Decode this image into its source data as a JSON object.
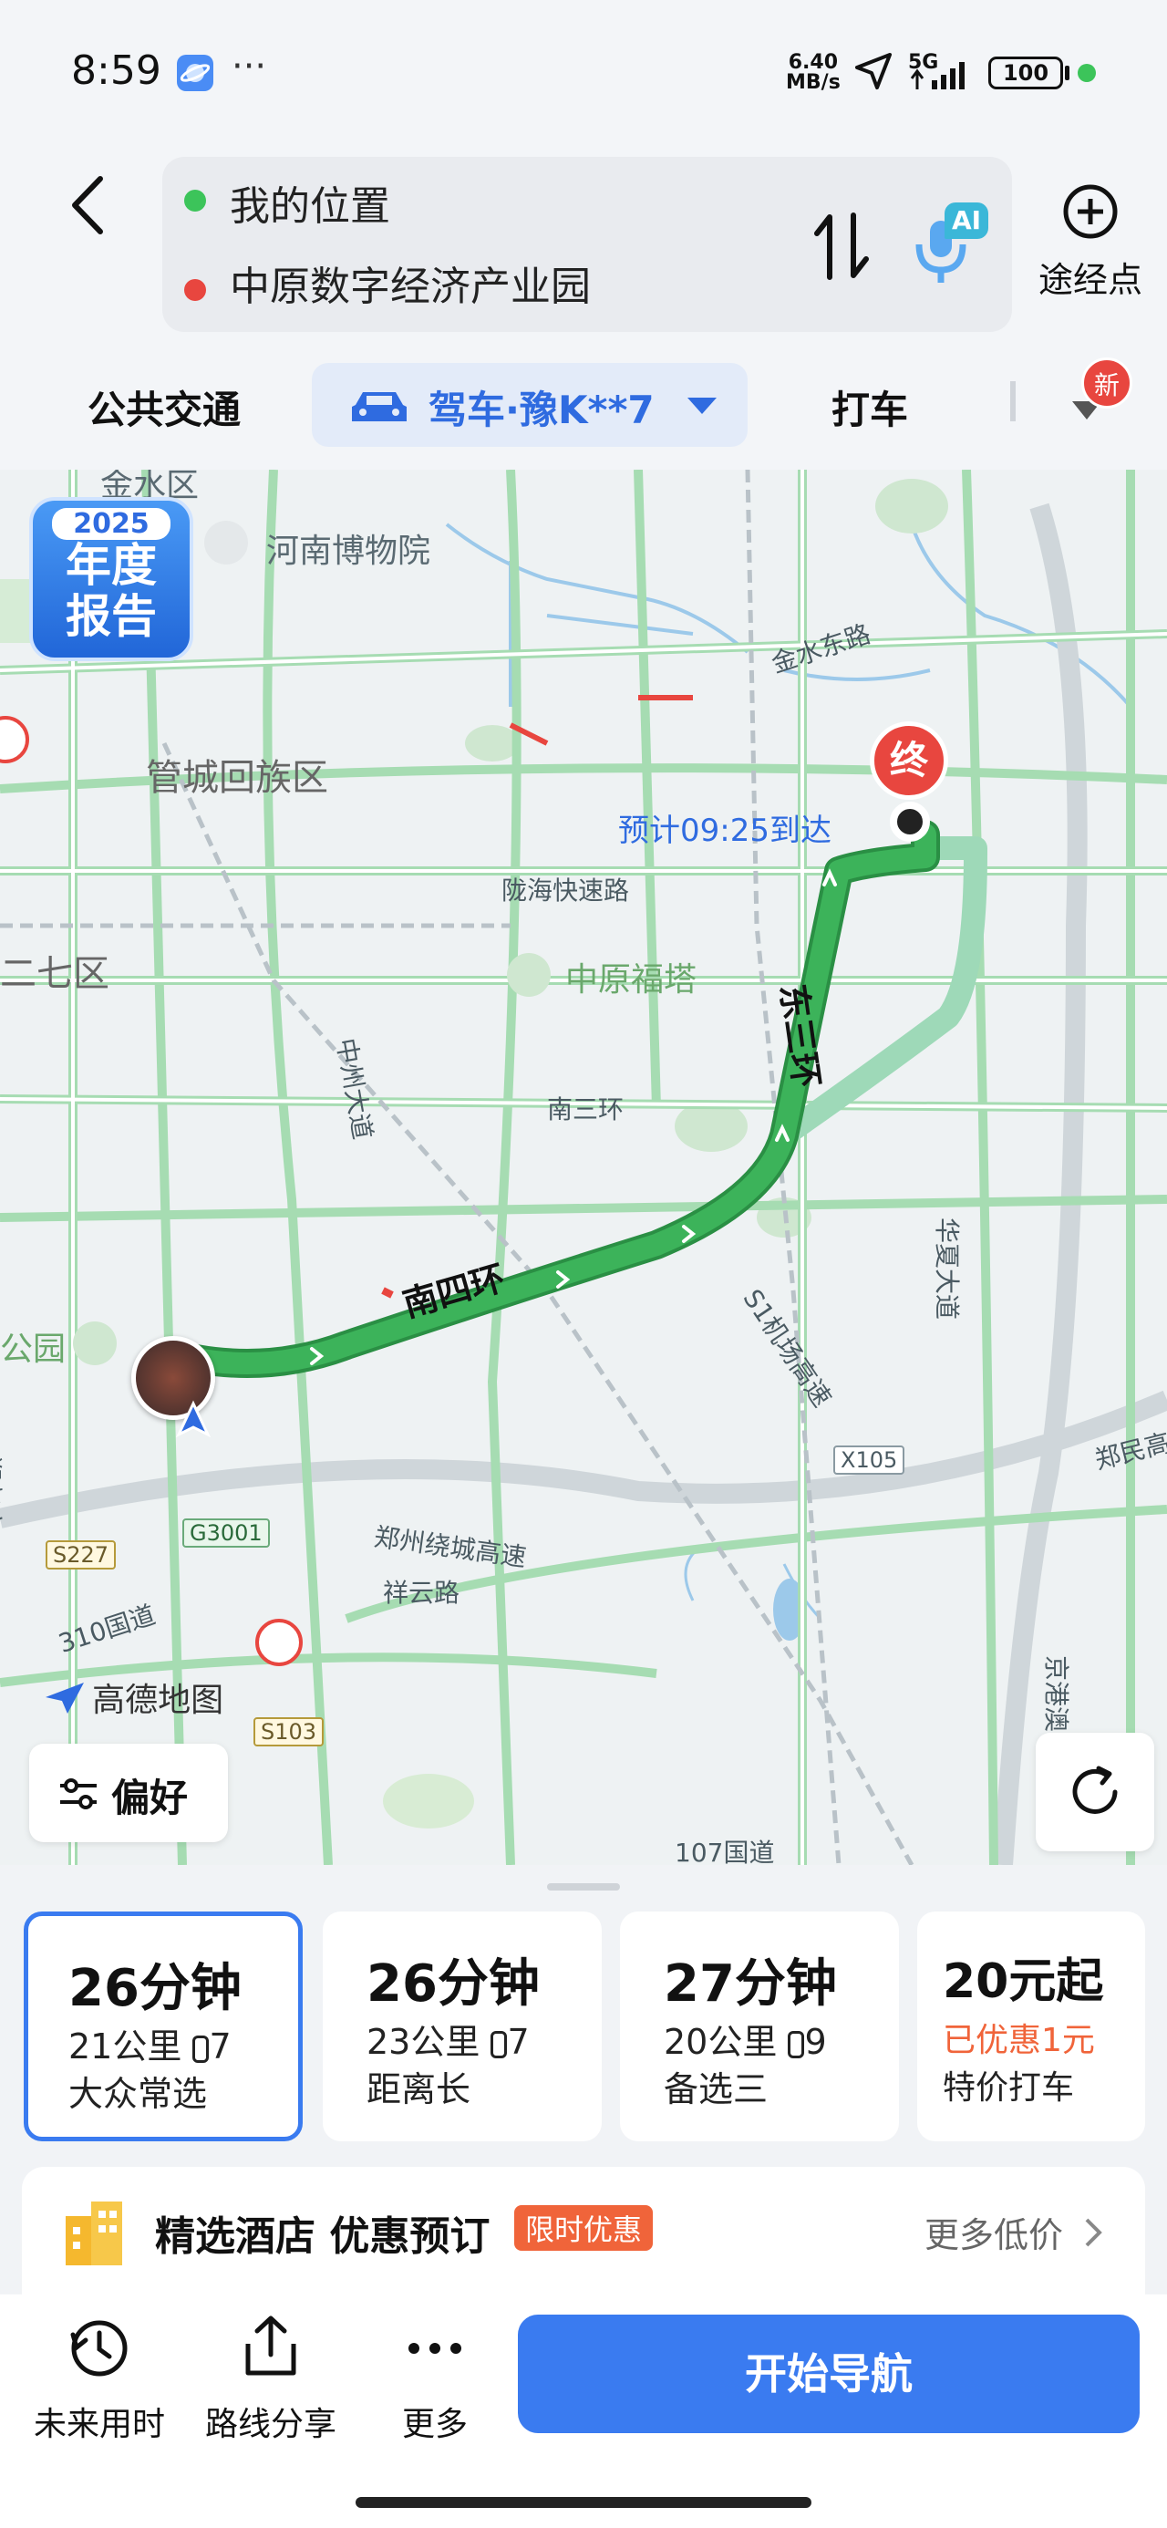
{
  "status": {
    "time": "8:59",
    "more": "···",
    "net_speed_top": "6.40",
    "net_speed_bottom": "MB/s",
    "network": "5G",
    "battery": "100"
  },
  "search": {
    "origin": "我的位置",
    "destination": "中原数字经济产业园",
    "ai_badge": "AI",
    "waypoint_label": "途经点"
  },
  "modes": {
    "transit": "公共交通",
    "drive": "驾车·豫K**7",
    "taxi": "打车",
    "new_badge": "新"
  },
  "map": {
    "report_year": "2025",
    "report_line1": "年度",
    "report_line2": "报告",
    "eta_label": "预计09:25到达",
    "end_marker": "终",
    "pref_button": "偏好",
    "brand": "高德地图",
    "labels": {
      "jinshui": "金水区",
      "museum": "河南博物院",
      "guancheng": "管城回族区",
      "erqi": "二七区",
      "tower": "中原福塔",
      "park": "公园",
      "jinshui_east": "金水东路",
      "longhai": "陇海快速路",
      "zhongzhou": "中州大道",
      "nansan": "南三环",
      "dongsan": "东三环",
      "nansi": "南四环",
      "s1": "S1机场高速",
      "huaxia": "华夏大道",
      "zhengmin": "郑民高",
      "x105": "X105",
      "g3001": "G3001",
      "s227": "S227",
      "s103": "S103",
      "ring_exp": "郑州绕城高速",
      "xiangyun": "祥云路",
      "g310": "310国道",
      "g107": "107国道",
      "jinggang": "京港澳",
      "left_edge": "郑尧高"
    }
  },
  "routes": [
    {
      "time": "26分钟",
      "detail": "21公里",
      "lights": "7",
      "tag": "大众常选",
      "selected": true
    },
    {
      "time": "26分钟",
      "detail": "23公里",
      "lights": "7",
      "tag": "距离长",
      "selected": false
    },
    {
      "time": "27分钟",
      "detail": "20公里",
      "lights": "9",
      "tag": "备选三",
      "selected": false
    }
  ],
  "taxi_card": {
    "price": "20元起",
    "discount": "已优惠1元",
    "tag": "特价打车"
  },
  "hotel": {
    "title": "精选酒店 优惠预订",
    "badge": "限时优惠",
    "more": "更多低价"
  },
  "bottom": {
    "future": "未来用时",
    "share": "路线分享",
    "more": "更多",
    "start": "开始导航"
  },
  "colors": {
    "route_main": "#3cb35a",
    "route_alt": "#9ed9b8",
    "accent_blue": "#3a7bf0",
    "end_red": "#e8463f",
    "discount_orange": "#f0643a"
  }
}
